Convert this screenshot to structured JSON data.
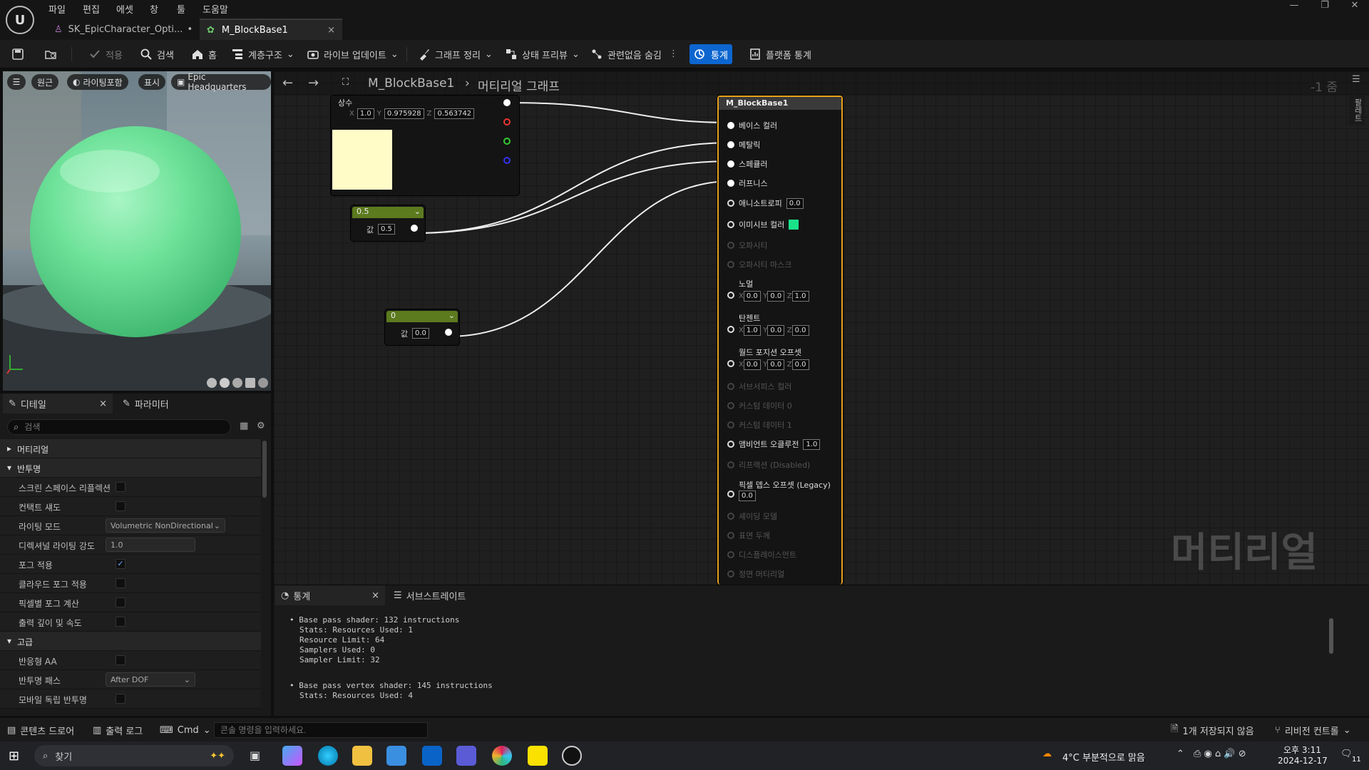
{
  "menu": {
    "file": "파일",
    "edit": "편집",
    "asset": "에셋",
    "window": "창",
    "tools": "툴",
    "help": "도움말"
  },
  "tabs": [
    {
      "label": "SK_EpicCharacter_Opti..."
    },
    {
      "label": "M_BlockBase1"
    }
  ],
  "toolbar": {
    "apply": "적용",
    "search": "검색",
    "home": "홈",
    "hierarchy": "계층구조",
    "live_update": "라이브 업데이트",
    "clean_graph": "그래프 정리",
    "preview_state": "상태 프리뷰",
    "hide_unrelated": "관련없음 숨김",
    "stats": "통계",
    "platform_stats": "플랫폼 통계"
  },
  "viewport": {
    "perspective": "원근",
    "lighting": "라이팅포함",
    "show": "표시",
    "hdri": "Epic Headquarters"
  },
  "details": {
    "tab_details": "디테일",
    "tab_params": "파라미터",
    "search_placeholder": "검색",
    "cat_material": "머티리얼",
    "cat_translucency": "반투명",
    "cat_advanced": "고급",
    "rows": [
      {
        "label": "스크린 스페이스 리플렉션",
        "type": "check",
        "checked": false
      },
      {
        "label": "컨택트 섀도",
        "type": "check",
        "checked": false
      },
      {
        "label": "라이팅 모드",
        "type": "drop",
        "value": "Volumetric NonDirectional"
      },
      {
        "label": "디렉셔널 라이팅 강도",
        "type": "num",
        "value": "1.0"
      },
      {
        "label": "포그 적용",
        "type": "check",
        "checked": true
      },
      {
        "label": "클라우드 포그 적용",
        "type": "check",
        "checked": false
      },
      {
        "label": "픽셀별 포그 계산",
        "type": "check",
        "checked": false
      },
      {
        "label": "출력 깊이 및 속도",
        "type": "check",
        "checked": false
      }
    ],
    "adv_rows": [
      {
        "label": "반응형 AA",
        "type": "check",
        "checked": false
      },
      {
        "label": "반투명 패스",
        "type": "drop",
        "value": "After DOF"
      },
      {
        "label": "모바일 독립 반투명",
        "type": "check",
        "checked": false
      }
    ]
  },
  "graph": {
    "breadcrumb_asset": "M_BlockBase1",
    "breadcrumb_graph": "머티리얼 그래프",
    "zoom": "-1 줌",
    "watermark": "머티리얼",
    "side_label": "팔레트",
    "const3": {
      "title": "상수",
      "x": "1.0",
      "y": "0.975928",
      "z": "0.563742",
      "color": "#fffcc8"
    },
    "scalar1": {
      "title": "0.5",
      "label": "값",
      "value": "0.5"
    },
    "scalar2": {
      "title": "0",
      "label": "값",
      "value": "0.0"
    },
    "result": {
      "title": "M_BlockBase1",
      "pins": {
        "base_color": "베이스 컬러",
        "metallic": "메탈릭",
        "specular": "스페큘러",
        "roughness": "러프니스",
        "anisotropy": "애니소트로피",
        "anisotropy_val": "0.0",
        "emissive": "이미시브 컬러",
        "emissive_color": "#19e38a",
        "opacity": "오파시티",
        "opacity_mask": "오파시티 마스크",
        "normal": "노멀",
        "normal_x": "0.0",
        "normal_y": "0.0",
        "normal_z": "1.0",
        "tangent": "탄젠트",
        "tangent_x": "1.0",
        "tangent_y": "0.0",
        "tangent_z": "0.0",
        "wpo": "월드 포지션 오프셋",
        "wpo_x": "0.0",
        "wpo_y": "0.0",
        "wpo_z": "0.0",
        "subsurface": "서브서피스 컬러",
        "custom0": "커스텀 데이터 0",
        "custom1": "커스텀 데이터 1",
        "ao": "앰비언트 오클루전",
        "ao_val": "1.0",
        "refraction": "리프랙션 (Disabled)",
        "pdo": "픽셀 뎁스 오프셋 (Legacy)",
        "pdo_val": "0.0",
        "shading_model": "셰이딩 모델",
        "surface_thickness": "표면 두께",
        "displacement": "디스플레이스먼트",
        "front_material": "정면 머티리얼"
      }
    }
  },
  "stats": {
    "tab": "통계",
    "tab2": "서브스트레이트",
    "lines1": [
      "Base pass shader: 132 instructions",
      "Stats: Resources Used: 1",
      "Resource Limit: 64",
      "Samplers Used: 0",
      "Sampler Limit: 32"
    ],
    "lines2": [
      "Base pass vertex shader: 145 instructions",
      "Stats: Resources Used: 4"
    ]
  },
  "bottombar": {
    "content_drawer": "콘텐츠 드로어",
    "output_log": "출력 로그",
    "cmd": "Cmd",
    "console_placeholder": "콘솔 명령을 입력하세요.",
    "unsaved": "1개 저장되지 않음",
    "revision": "리비전 컨트롤"
  },
  "taskbar": {
    "search": "찾기",
    "weather": "4°C  부분적으로 맑음",
    "time": "오후 3:11",
    "date": "2024-12-17",
    "badge": "11"
  }
}
